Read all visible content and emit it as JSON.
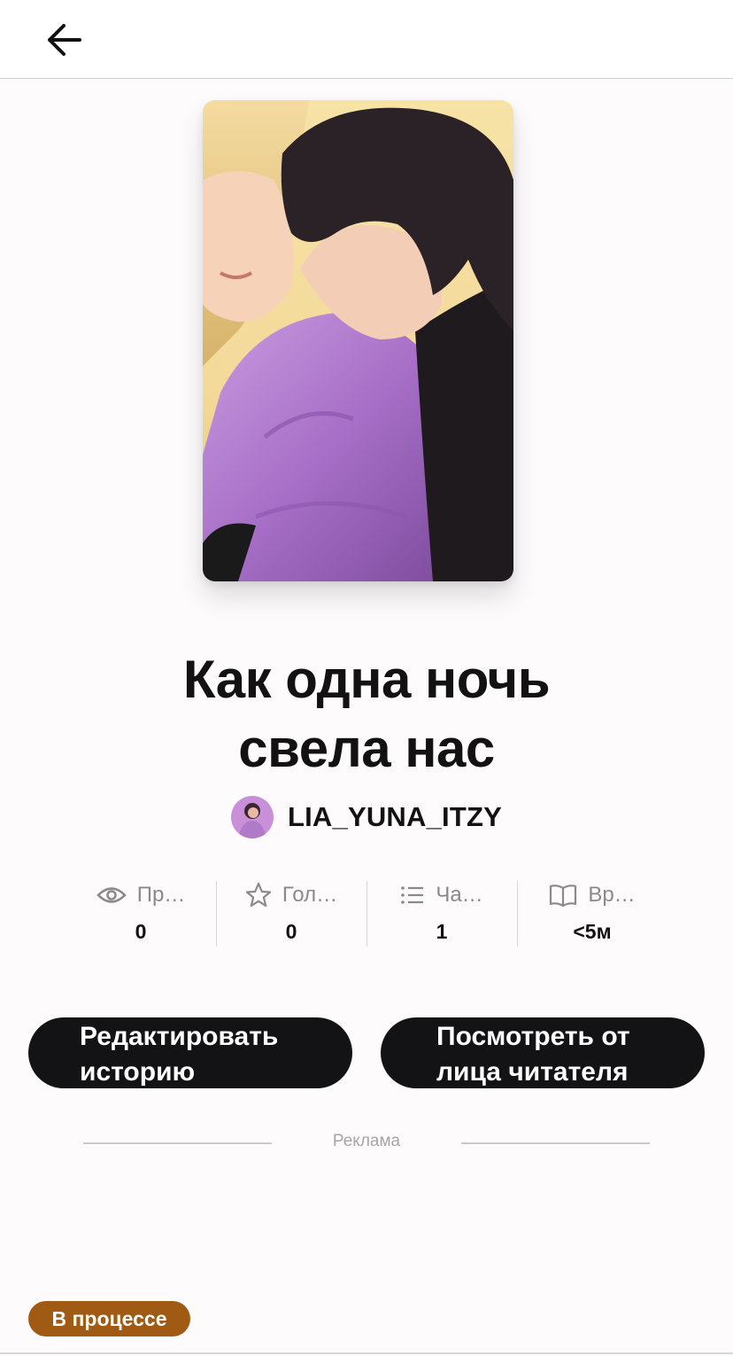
{
  "header": {
    "back_icon": "arrow-left-icon"
  },
  "story": {
    "title_line1": "Как одна ночь",
    "title_line2": "свела нас",
    "author": "LIA_YUNA_ITZY"
  },
  "stats": [
    {
      "icon": "eye-icon",
      "label": "Пр…",
      "value": "0"
    },
    {
      "icon": "star-icon",
      "label": "Гол…",
      "value": "0"
    },
    {
      "icon": "list-icon",
      "label": "Ча…",
      "value": "1"
    },
    {
      "icon": "book-icon",
      "label": "Вр…",
      "value": "<5м"
    }
  ],
  "actions": {
    "edit_line1": "Редактировать",
    "edit_line2": "историю",
    "view_line1": "Посмотреть от",
    "view_line2": "лица читателя"
  },
  "ad_label": "Реклама",
  "status": {
    "label": "В процессе",
    "color": "#a05a13"
  }
}
